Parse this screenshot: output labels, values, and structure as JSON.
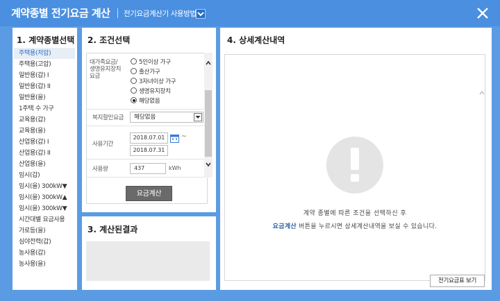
{
  "window": {
    "title": "계약종별 전기요금 계산",
    "howto_label": "전기요금계산기 사용방법",
    "close_icon": "close-icon",
    "colors": {
      "titlebar": "#4a8fe0",
      "frame": "#5b9be3",
      "accent": "#2d6cc0"
    }
  },
  "contract": {
    "heading": "1. 계약종별선택",
    "items": [
      "주택용(저압)",
      "주택용(고압)",
      "일반용(갑) I",
      "일반용(갑) II",
      "일반용(을)",
      "1주택 수 가구",
      "교육용(갑)",
      "교육용(을)",
      "산업용(갑) I",
      "산업용(갑) II",
      "산업용(을)",
      "임시(갑)",
      "임시(을) 300kW▼",
      "임시(을) 300kW▲",
      "임시(을) 300kW▼",
      "시간대별 요금사용",
      "가로등(을)",
      "심야전력(갑)",
      "농사용(갑)",
      "농사용(을)"
    ],
    "selected_index": 0
  },
  "conditions": {
    "heading": "2. 조건선택",
    "family_label_1": "대가족요금/",
    "family_label_2": "생명유지장치",
    "family_label_3": "요금",
    "options": [
      "5인이상 가구",
      "출산가구",
      "3자녀이상 가구",
      "생명유지장치",
      "해당없음"
    ],
    "selected_option": 4,
    "welfare_label": "복지할인요금",
    "welfare_value": "해당없음",
    "period_label": "사용기간",
    "start_date": "2018.07.01",
    "end_date": "2018.07.31",
    "tilde": "~",
    "usage_label": "사용량",
    "usage_value": "437",
    "usage_unit": "kWh",
    "calc_button": "요금계산"
  },
  "result": {
    "heading": "3. 계산된결과"
  },
  "detail": {
    "heading": "4. 상세계산내역",
    "msg_line1": "계약 종별에 따른 조건을 선택하신 후",
    "msg_highlight": "요금계산",
    "msg_line2_rest": " 버튼을 누르시면 상세계산내역을 보실 수 있습니다.",
    "table_button": "전기요금표 보기"
  }
}
